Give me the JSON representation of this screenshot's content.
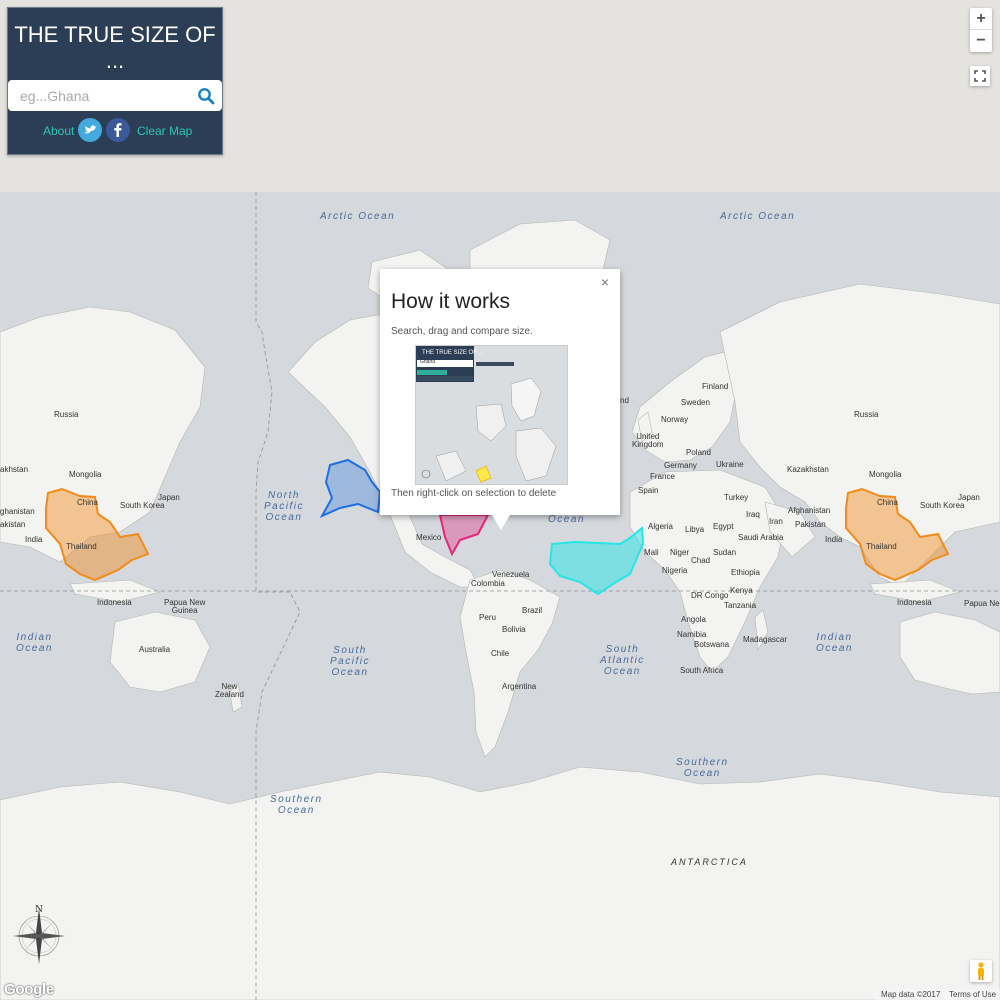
{
  "app": {
    "title": "THE TRUE SIZE OF ...",
    "accent_color": "#2fc4b2",
    "panel_color": "#2b3e55"
  },
  "search": {
    "placeholder": "eg...Ghana",
    "icon": "search-icon"
  },
  "links": {
    "about": "About",
    "twitter_icon": "twitter-icon",
    "facebook_icon": "facebook-icon",
    "clear_map": "Clear Map"
  },
  "map_controls": {
    "zoom_in": "+",
    "zoom_out": "−",
    "fullscreen_icon": "fullscreen-icon"
  },
  "popup": {
    "title": "How it works",
    "subtitle": "Search, drag and compare size.",
    "footer": "Then right-click on selection to delete",
    "close": "×",
    "thumbnail": {
      "title": "THE TRUE SIZE OF ...",
      "search_text": "Ghana"
    }
  },
  "overlays": [
    {
      "name": "China",
      "color": "#f28b1c"
    },
    {
      "name": "Alaska",
      "color": "#1f6fe0"
    },
    {
      "name": "Mexico",
      "color": "#e6267e"
    },
    {
      "name": "United States",
      "color": "#26e6e6"
    },
    {
      "name": "China",
      "color": "#f28b1c"
    }
  ],
  "ocean_labels": [
    "Arctic Ocean",
    "Arctic Ocean",
    "North\nPacific\nOcean",
    "Ocean",
    "Indian\nOcean",
    "South\nPacific\nOcean",
    "South\nAtlantic\nOcean",
    "Indian\nOcean",
    "Southern\nOcean",
    "Southern\nOcean"
  ],
  "antarctica_label": "ANTARCTICA",
  "place_labels": [
    "Russia",
    "akhstan",
    "Mongolia",
    "China",
    "Japan",
    "South Korea",
    "ghanistan",
    "akistan",
    "India",
    "Thailand",
    "Indonesia",
    "Papua New\nGuinea",
    "Australia",
    "New\nZealand",
    "Mexico",
    "Venezuela",
    "Colombia",
    "Peru",
    "Brazil",
    "Bolivia",
    "Chile",
    "Argentina",
    "nd",
    "Finland",
    "Sweden",
    "Norway",
    "United\nKingdom",
    "Poland",
    "Germany",
    "Ukraine",
    "France",
    "Spain",
    "Turkey",
    "Algeria",
    "Libya",
    "Egypt",
    "Mali",
    "Niger",
    "Chad",
    "Sudan",
    "Nigeria",
    "Ethiopia",
    "Kenya",
    "DR Congo",
    "Tanzania",
    "Angola",
    "Namibia",
    "Botswana",
    "South Africa",
    "Madagascar",
    "Iraq",
    "Iran",
    "Saudi Arabia",
    "Kazakhstan",
    "Mongolia",
    "China",
    "Japan",
    "South Korea",
    "Afghanistan",
    "Pakistan",
    "India",
    "Thailand",
    "Indonesia",
    "Papua Ne",
    "Russia"
  ],
  "compass_label": "N",
  "compass_icon": "compass-rose-icon",
  "pegman_icon": "pegman-icon",
  "google_logo": "Google",
  "attribution": {
    "map_data": "Map data ©2017",
    "terms": "Terms of Use"
  }
}
